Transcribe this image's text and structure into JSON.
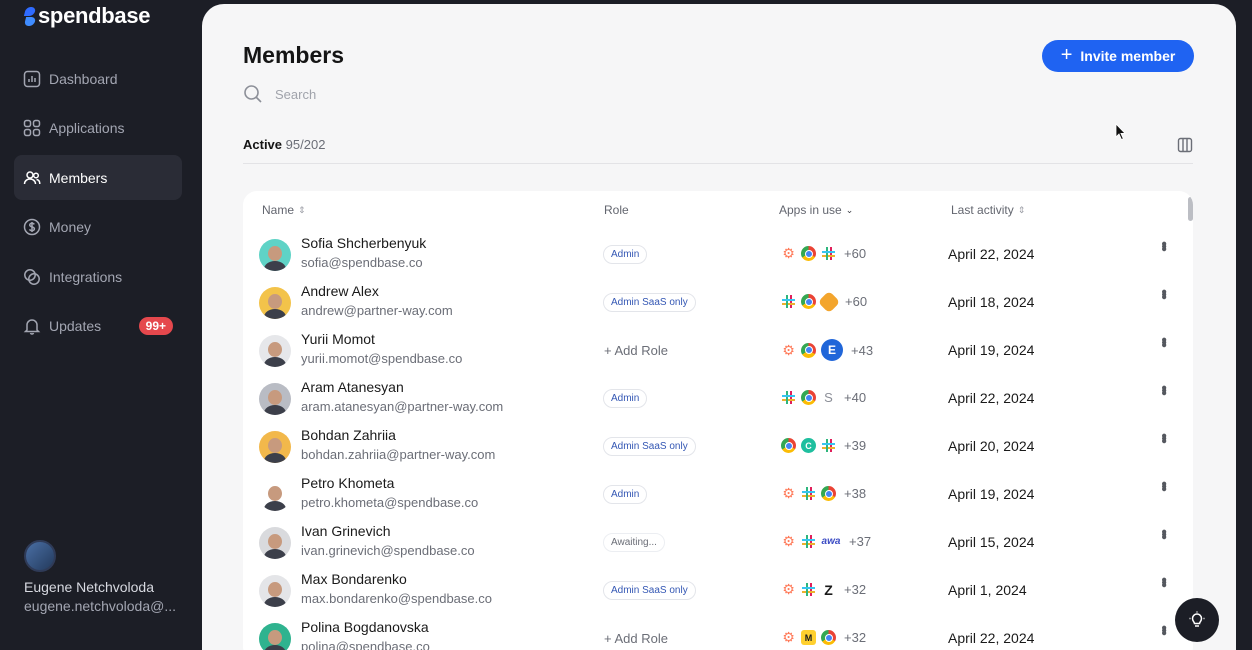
{
  "brand": {
    "name": "spendbase"
  },
  "sidebar": {
    "items": [
      {
        "label": "Dashboard",
        "icon": "chart-icon",
        "active": false
      },
      {
        "label": "Applications",
        "icon": "grid-icon",
        "active": false
      },
      {
        "label": "Members",
        "icon": "users-icon",
        "active": true
      },
      {
        "label": "Money",
        "icon": "dollar-icon",
        "active": false
      },
      {
        "label": "Integrations",
        "icon": "link-icon",
        "active": false
      },
      {
        "label": "Updates",
        "icon": "bell-icon",
        "active": false,
        "badge": "99+"
      }
    ],
    "profile": {
      "name": "Eugene Netchvoloda",
      "email": "eugene.netchvoloda@..."
    }
  },
  "main": {
    "title": "Members",
    "invite_label": "Invite member",
    "search_placeholder": "Search",
    "tab_label": "Active",
    "tab_count": "95/202"
  },
  "table": {
    "headers": {
      "name": "Name",
      "role": "Role",
      "apps": "Apps in use",
      "activity": "Last activity"
    },
    "rows": [
      {
        "name": "Sofia Shcherbenyuk",
        "email": "sofia@spendbase.co",
        "role": "Admin",
        "role_type": "chip",
        "apps": [
          "hubspot",
          "chrome",
          "slack"
        ],
        "more": "+60",
        "activity": "April 22, 2024",
        "avatar_color": "#5fd3c6"
      },
      {
        "name": "Andrew Alex",
        "email": "andrew@partner-way.com",
        "role": "Admin SaaS only",
        "role_type": "chip",
        "apps": [
          "slack",
          "chrome",
          "hex"
        ],
        "more": "+60",
        "activity": "April 18, 2024",
        "avatar_color": "#f3c34a"
      },
      {
        "name": "Yurii Momot",
        "email": "yurii.momot@spendbase.co",
        "role": "+ Add Role",
        "role_type": "add",
        "apps": [
          "hubspot",
          "chrome",
          "elementor"
        ],
        "more": "+43",
        "activity": "April 19, 2024",
        "avatar_color": "#e6e7ea"
      },
      {
        "name": "Aram Atanesyan",
        "email": "aram.atanesyan@partner-way.com",
        "role": "Admin",
        "role_type": "chip",
        "apps": [
          "slack",
          "chrome",
          "s"
        ],
        "more": "+40",
        "activity": "April 22, 2024",
        "avatar_color": "#b9bcc4"
      },
      {
        "name": "Bohdan Zahriia",
        "email": "bohdan.zahriia@partner-way.com",
        "role": "Admin SaaS only",
        "role_type": "chip",
        "apps": [
          "chrome",
          "cyan",
          "slack"
        ],
        "more": "+39",
        "activity": "April 20, 2024",
        "avatar_color": "#f2b84b"
      },
      {
        "name": "Petro Khometa",
        "email": "petro.khometa@spendbase.co",
        "role": "Admin",
        "role_type": "chip",
        "apps": [
          "hubspot",
          "slack",
          "chrome"
        ],
        "more": "+38",
        "activity": "April 19, 2024",
        "avatar_color": "#ffffff"
      },
      {
        "name": "Ivan Grinevich",
        "email": "ivan.grinevich@spendbase.co",
        "role": "Awaiting...",
        "role_type": "await",
        "apps": [
          "hubspot",
          "slack",
          "wa"
        ],
        "more": "+37",
        "activity": "April 15, 2024",
        "avatar_color": "#d9dadd"
      },
      {
        "name": "Max Bondarenko",
        "email": "max.bondarenko@spendbase.co",
        "role": "Admin SaaS only",
        "role_type": "chip",
        "apps": [
          "hubspot",
          "slack",
          "zendesk"
        ],
        "more": "+32",
        "activity": "April 1, 2024",
        "avatar_color": "#e4e5e8"
      },
      {
        "name": "Polina Bogdanovska",
        "email": "polina@spendbase.co",
        "role": "+ Add Role",
        "role_type": "add",
        "apps": [
          "hubspot",
          "miro",
          "chrome"
        ],
        "more": "+32",
        "activity": "April 22, 2024",
        "avatar_color": "#2fb38f"
      }
    ]
  },
  "app_glyphs": {
    "hubspot": "⚙",
    "elementor": "E",
    "s": "S",
    "cyan": "C",
    "wa": "awa",
    "zendesk": "Z",
    "miro": "M"
  },
  "colors": {
    "accent": "#1f63f2",
    "sidebar_bg": "#1c1e26",
    "badge": "#e5484d"
  }
}
